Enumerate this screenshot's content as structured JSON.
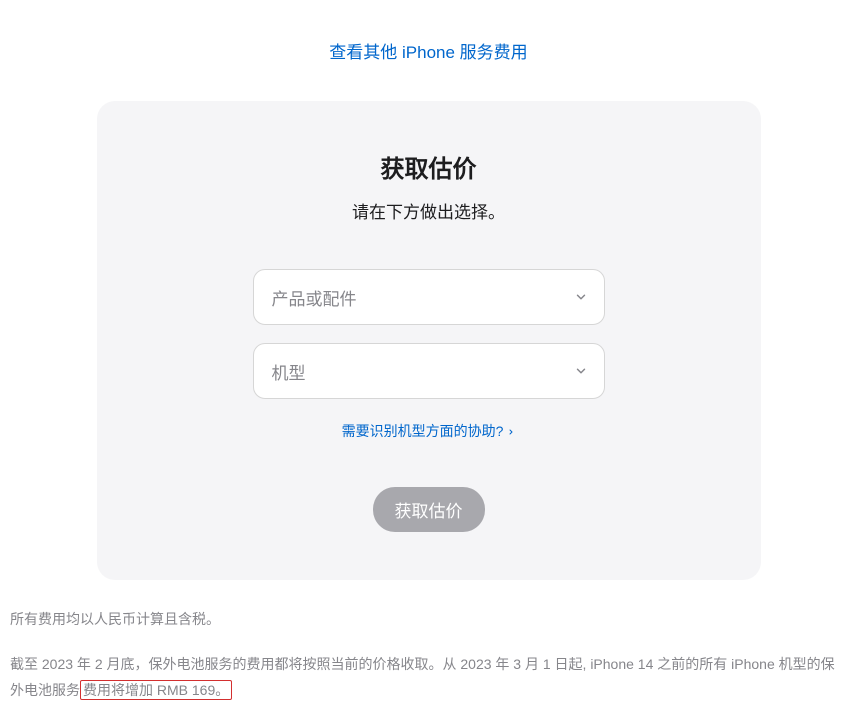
{
  "topLink": "查看其他 iPhone 服务费用",
  "card": {
    "title": "获取估价",
    "subtitle": "请在下方做出选择。",
    "select1": "产品或配件",
    "select2": "机型",
    "helpLink": "需要识别机型方面的协助?",
    "button": "获取估价"
  },
  "footnote1": "所有费用均以人民币计算且含税。",
  "footnote2_a": "截至 2023 年 2 月底，保外电池服务的费用都将按照当前的价格收取。从 2023 年 3 月 1 日起, iPhone 14 之前的所有 iPhone 机型的保外电池服务",
  "footnote2_b": "费用将增加 RMB 169。"
}
